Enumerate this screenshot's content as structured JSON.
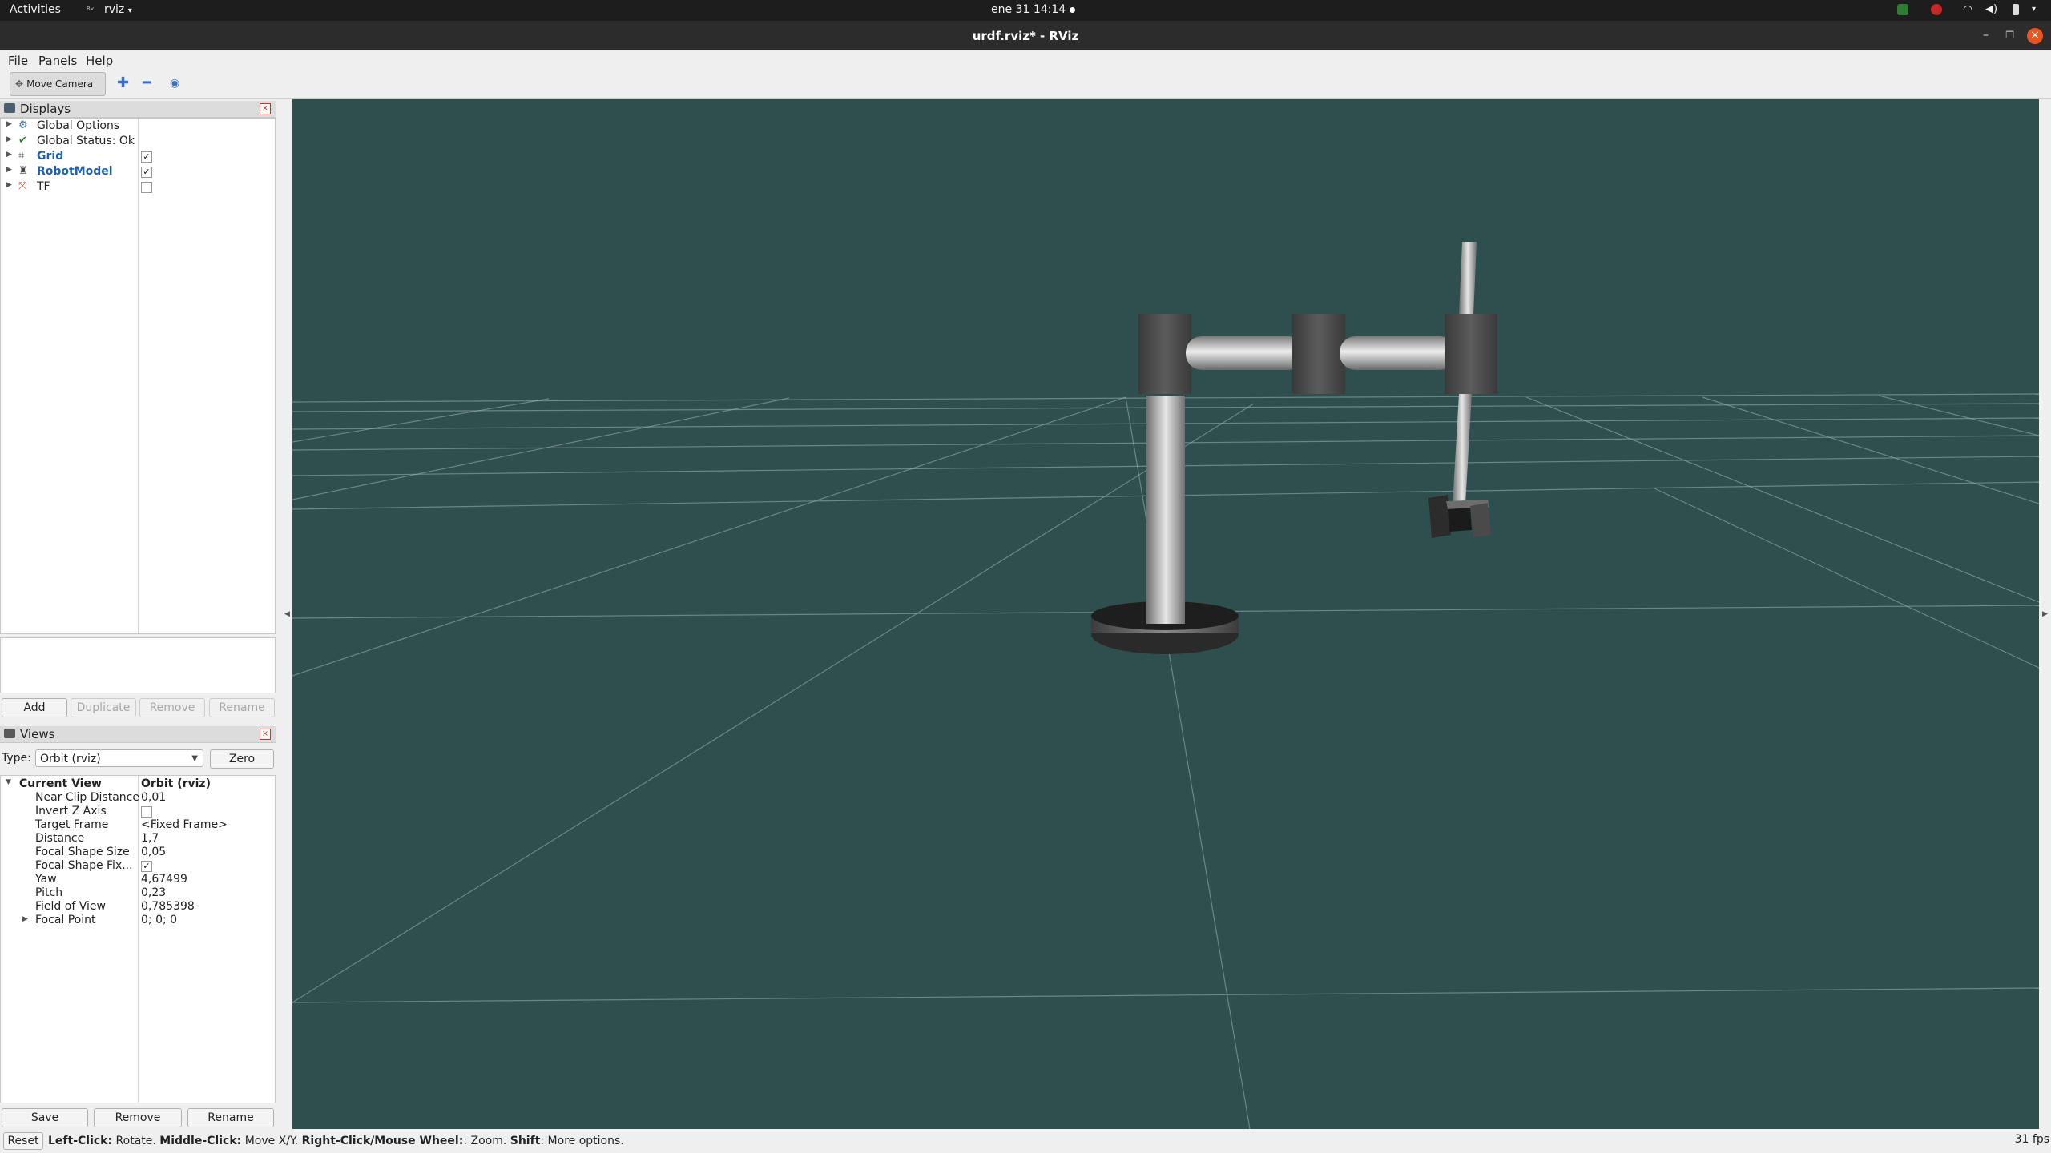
{
  "topbar": {
    "activities": "Activities",
    "app_menu": "rviz",
    "datetime": "ene 31  14:14"
  },
  "window": {
    "title": "urdf.rviz* - RViz"
  },
  "menu": {
    "file": "File",
    "panels": "Panels",
    "help": "Help"
  },
  "toolbar": {
    "move_camera": "Move Camera",
    "tools": [
      "interact-icon",
      "measure-icon",
      "focus-icon"
    ]
  },
  "displays": {
    "title": "Displays",
    "items": [
      {
        "label": "Global Options",
        "icon": "settings-icon"
      },
      {
        "label": "Global Status: Ok",
        "icon": "check-icon"
      },
      {
        "label": "Grid",
        "icon": "grid-icon",
        "checked": true
      },
      {
        "label": "RobotModel",
        "icon": "robot-icon",
        "checked": true
      },
      {
        "label": "TF",
        "icon": "tf-icon",
        "checked": false
      }
    ],
    "buttons": {
      "add": "Add",
      "duplicate": "Duplicate",
      "remove": "Remove",
      "rename": "Rename"
    }
  },
  "views": {
    "title": "Views",
    "type_label": "Type:",
    "type_value": "Orbit (rviz)",
    "zero": "Zero",
    "current_view": {
      "label": "Current View",
      "value": "Orbit (rviz)"
    },
    "props": [
      {
        "label": "Near Clip Distance",
        "value": "0,01"
      },
      {
        "label": "Invert Z Axis",
        "value": "",
        "checkbox": false
      },
      {
        "label": "Target Frame",
        "value": "<Fixed Frame>"
      },
      {
        "label": "Distance",
        "value": "1,7"
      },
      {
        "label": "Focal Shape Size",
        "value": "0,05"
      },
      {
        "label": "Focal Shape Fix...",
        "value": "",
        "checkbox": true
      },
      {
        "label": "Yaw",
        "value": "4,67499"
      },
      {
        "label": "Pitch",
        "value": "0,23"
      },
      {
        "label": "Field of View",
        "value": "0,785398"
      },
      {
        "label": "Focal Point",
        "value": "0; 0; 0"
      }
    ],
    "buttons": {
      "save": "Save",
      "remove": "Remove",
      "rename": "Rename"
    }
  },
  "statusbar": {
    "reset": "Reset",
    "hint_parts": [
      {
        "text": "Left-Click:",
        "bold": true
      },
      {
        "text": " Rotate. ",
        "bold": false
      },
      {
        "text": "Middle-Click:",
        "bold": true
      },
      {
        "text": " Move X/Y. ",
        "bold": false
      },
      {
        "text": "Right-Click/Mouse Wheel:",
        "bold": true
      },
      {
        "text": ": Zoom. ",
        "bold": false
      },
      {
        "text": "Shift",
        "bold": true
      },
      {
        "text": ": More options.",
        "bold": false
      }
    ],
    "fps": "31 fps"
  },
  "colors": {
    "viewport_bg": "#2f4f4f",
    "grid_line": "#a0b4b4",
    "link_label": "#1d5fb4"
  }
}
